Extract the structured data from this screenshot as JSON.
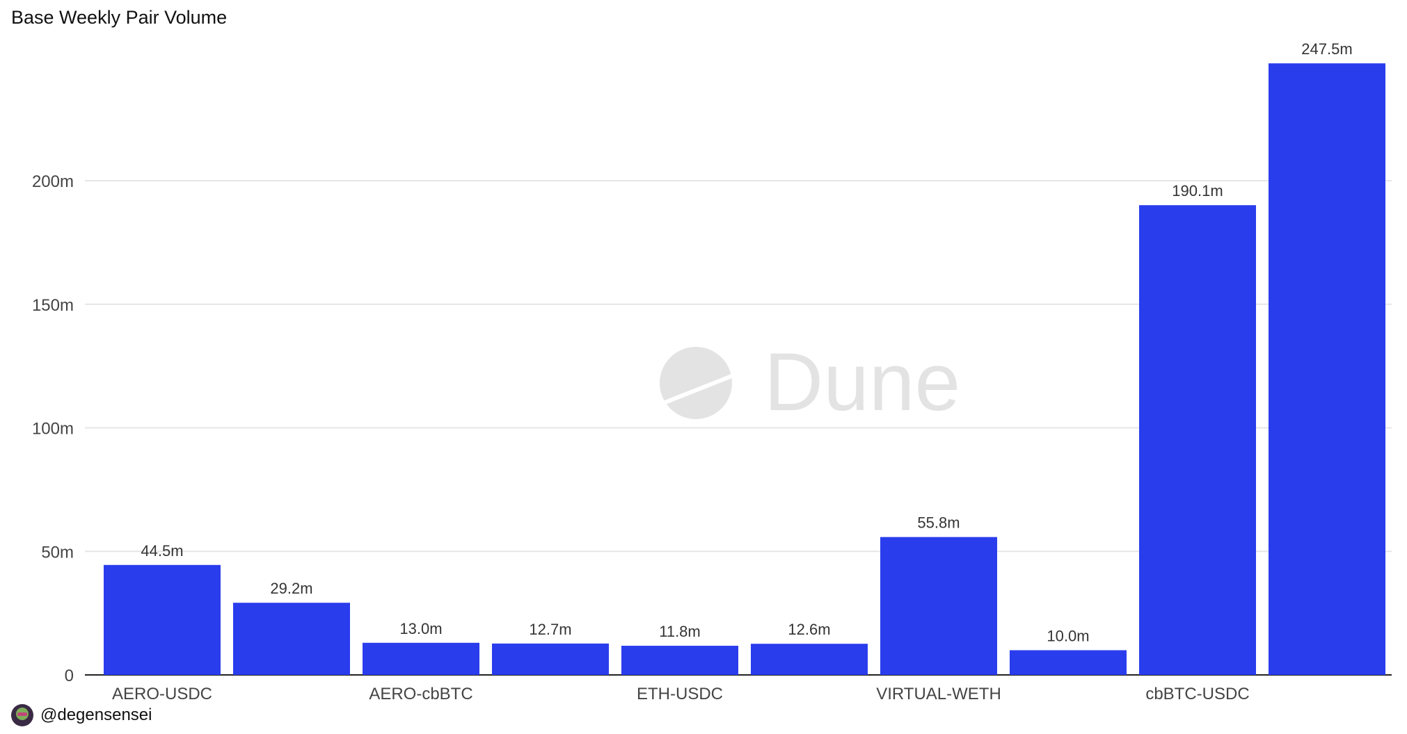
{
  "header": {
    "title": "Base Weekly Pair Volume"
  },
  "watermark": {
    "text": "Dune"
  },
  "footer": {
    "handle": "@degensensei"
  },
  "colors": {
    "bar": "#2a3ded",
    "grid": "#e6e6e6",
    "axis_text": "#444444",
    "watermark": "#e3e3e3"
  },
  "chart_data": {
    "type": "bar",
    "title": "Base Weekly Pair Volume",
    "xlabel": "",
    "ylabel": "",
    "categories": [
      "AERO-USDC",
      "",
      "AERO-cbBTC",
      "",
      "ETH-USDC",
      "",
      "VIRTUAL-WETH",
      "",
      "cbBTC-USDC",
      ""
    ],
    "values": [
      44.5,
      29.2,
      13.0,
      12.7,
      11.8,
      12.6,
      55.8,
      10.0,
      190.1,
      247.5
    ],
    "data_labels": [
      "44.5m",
      "29.2m",
      "13.0m",
      "12.7m",
      "11.8m",
      "12.6m",
      "55.8m",
      "10.0m",
      "190.1m",
      "247.5m"
    ],
    "yticks": [
      0,
      50,
      100,
      150,
      200
    ],
    "ytick_labels": [
      "0",
      "50m",
      "100m",
      "150m",
      "200m"
    ],
    "ylim": [
      0,
      250
    ],
    "grid": true,
    "legend": "none"
  }
}
